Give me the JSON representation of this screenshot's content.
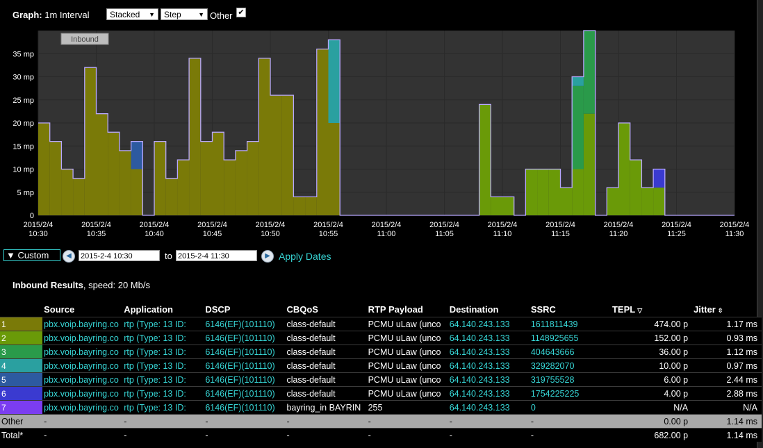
{
  "controls": {
    "graph_label": "Graph:",
    "interval": "1m Interval",
    "mode_select": "Stacked",
    "style_select": "Step",
    "other_label": "Other",
    "other_checked": true
  },
  "chart_data": {
    "type": "area",
    "style": "stacked-step",
    "tag": "Inbound",
    "y_tick_labels": [
      "0",
      "5 mp",
      "10 mp",
      "15 mp",
      "20 mp",
      "25 mp",
      "30 mp",
      "35 mp"
    ],
    "ylim": [
      0,
      40
    ],
    "x_tick_labels": [
      [
        "2015/2/4",
        "10:30"
      ],
      [
        "2015/2/4",
        "10:35"
      ],
      [
        "2015/2/4",
        "10:40"
      ],
      [
        "2015/2/4",
        "10:45"
      ],
      [
        "2015/2/4",
        "10:50"
      ],
      [
        "2015/2/4",
        "10:55"
      ],
      [
        "2015/2/4",
        "11:00"
      ],
      [
        "2015/2/4",
        "11:05"
      ],
      [
        "2015/2/4",
        "11:10"
      ],
      [
        "2015/2/4",
        "11:15"
      ],
      [
        "2015/2/4",
        "11:20"
      ],
      [
        "2015/2/4",
        "11:25"
      ],
      [
        "2015/2/4",
        "11:30"
      ]
    ],
    "x_minutes_from": "10:30",
    "series": [
      {
        "color": "#7a7a08",
        "segments": [
          [
            0,
            20
          ],
          [
            1,
            16
          ],
          [
            2,
            10
          ],
          [
            3,
            8
          ],
          [
            4,
            32
          ],
          [
            5,
            22
          ],
          [
            6,
            18
          ],
          [
            7,
            14
          ],
          [
            8,
            10
          ],
          [
            9,
            0
          ],
          [
            10,
            16
          ],
          [
            11,
            8
          ],
          [
            12,
            12
          ],
          [
            13,
            34
          ],
          [
            14,
            16
          ],
          [
            15,
            18
          ],
          [
            16,
            12
          ],
          [
            17,
            14
          ],
          [
            18,
            16
          ],
          [
            19,
            34
          ],
          [
            20,
            26
          ],
          [
            21,
            26
          ],
          [
            22,
            4
          ],
          [
            23,
            4
          ],
          [
            24,
            36
          ],
          [
            25,
            20
          ],
          [
            26,
            0
          ]
        ]
      },
      {
        "color": "#6a9a08",
        "segments": [
          [
            38,
            24
          ],
          [
            39,
            4
          ],
          [
            40,
            4
          ],
          [
            41,
            0
          ],
          [
            42,
            10
          ],
          [
            43,
            10
          ],
          [
            44,
            10
          ],
          [
            45,
            6
          ],
          [
            46,
            10
          ],
          [
            47,
            22
          ],
          [
            48,
            0
          ],
          [
            49,
            6
          ],
          [
            50,
            20
          ],
          [
            51,
            12
          ],
          [
            52,
            6
          ],
          [
            53,
            6
          ],
          [
            54,
            0
          ]
        ]
      },
      {
        "color": "#2a9a4a",
        "segments": [
          [
            46,
            18
          ],
          [
            47,
            18
          ],
          [
            48,
            0
          ]
        ]
      },
      {
        "color": "#2aa0a0",
        "segments": [
          [
            25,
            18
          ],
          [
            26,
            0
          ],
          [
            46,
            2
          ],
          [
            47,
            0
          ]
        ]
      },
      {
        "color": "#2d5aa0",
        "segments": [
          [
            8,
            6
          ],
          [
            9,
            0
          ]
        ]
      },
      {
        "color": "#3a3ad0",
        "segments": [
          [
            53,
            4
          ],
          [
            54,
            0
          ]
        ]
      },
      {
        "color": "#7b3df0",
        "segments": []
      }
    ]
  },
  "dates": {
    "range_label": "▼ Custom",
    "from": "2015-2-4 10:30",
    "to_label": "to",
    "to": "2015-2-4 11:30",
    "apply_label": "Apply Dates"
  },
  "results": {
    "title": "Inbound Results",
    "speed": ", speed: 20 Mb/s",
    "columns": [
      "",
      "Source",
      "Application",
      "DSCP",
      "CBQoS",
      "RTP Payload",
      "Destination",
      "SSRC",
      "TEPL",
      "Jitter"
    ],
    "rows": [
      {
        "n": "1",
        "color": "#7a7a08",
        "source": "pbx.voip.bayring.co",
        "app": "rtp (Type: 13 ID:",
        "dscp": "6146(EF)(101110)",
        "cbqos": "class-default",
        "payload": "PCMU uLaw (unco",
        "dest": "64.140.243.133",
        "ssrc": "1611811439",
        "tepl": "474.00 p",
        "jitter": "1.17 ms"
      },
      {
        "n": "2",
        "color": "#6a9a08",
        "source": "pbx.voip.bayring.co",
        "app": "rtp (Type: 13 ID:",
        "dscp": "6146(EF)(101110)",
        "cbqos": "class-default",
        "payload": "PCMU uLaw (unco",
        "dest": "64.140.243.133",
        "ssrc": "1148925655",
        "tepl": "152.00 p",
        "jitter": "0.93 ms"
      },
      {
        "n": "3",
        "color": "#2a9a4a",
        "source": "pbx.voip.bayring.co",
        "app": "rtp (Type: 13 ID:",
        "dscp": "6146(EF)(101110)",
        "cbqos": "class-default",
        "payload": "PCMU uLaw (unco",
        "dest": "64.140.243.133",
        "ssrc": "404643666",
        "tepl": "36.00 p",
        "jitter": "1.12 ms"
      },
      {
        "n": "4",
        "color": "#2aa0a0",
        "source": "pbx.voip.bayring.co",
        "app": "rtp (Type: 13 ID:",
        "dscp": "6146(EF)(101110)",
        "cbqos": "class-default",
        "payload": "PCMU uLaw (unco",
        "dest": "64.140.243.133",
        "ssrc": "329282070",
        "tepl": "10.00 p",
        "jitter": "0.97 ms"
      },
      {
        "n": "5",
        "color": "#2d5aa0",
        "source": "pbx.voip.bayring.co",
        "app": "rtp (Type: 13 ID:",
        "dscp": "6146(EF)(101110)",
        "cbqos": "class-default",
        "payload": "PCMU uLaw (unco",
        "dest": "64.140.243.133",
        "ssrc": "319755528",
        "tepl": "6.00 p",
        "jitter": "2.44 ms"
      },
      {
        "n": "6",
        "color": "#3a3ad0",
        "source": "pbx.voip.bayring.co",
        "app": "rtp (Type: 13 ID:",
        "dscp": "6146(EF)(101110)",
        "cbqos": "class-default",
        "payload": "PCMU uLaw (unco",
        "dest": "64.140.243.133",
        "ssrc": "1754225225",
        "tepl": "4.00 p",
        "jitter": "2.88 ms"
      },
      {
        "n": "7",
        "color": "#7b3df0",
        "source": "pbx.voip.bayring.co",
        "app": "rtp (Type: 13 ID:",
        "dscp": "6146(EF)(101110)",
        "cbqos": "bayring_in BAYRIN",
        "payload": "255",
        "dest": "64.140.243.133",
        "ssrc": "0",
        "tepl": "N/A",
        "jitter": "N/A"
      }
    ],
    "other": {
      "label": "Other",
      "dash": "-",
      "tepl": "0.00 p",
      "jitter": "1.14 ms"
    },
    "total": {
      "label": "Total*",
      "dash": "-",
      "tepl": "682.00 p",
      "jitter": "1.14 ms"
    }
  }
}
